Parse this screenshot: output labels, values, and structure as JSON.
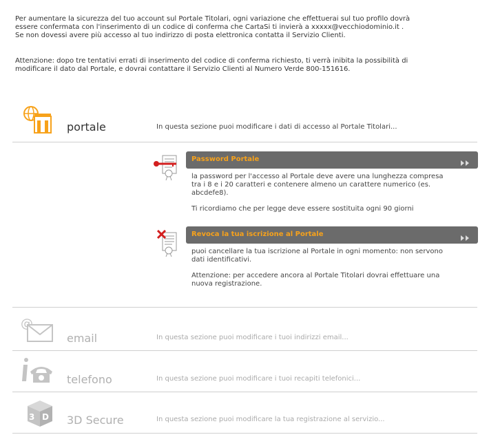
{
  "intro": {
    "line1": "Per aumentare la sicurezza del tuo account sul Portale Titolari, ogni variazione che effettuerai sul tuo profilo dovrà",
    "line2": "essere confermata con l'inserimento di un codice di conferma che CartaSi ti invierà a xxxxx@vecchiodominio.it .",
    "line3": "Se non dovessi avere più accesso al tuo indirizzo di posta elettronica contatta il Servizio Clienti.",
    "warn1": "Attenzione: dopo tre tentativi errati di inserimento del codice di conferma richiesto, ti verrà inibita la possibilità di",
    "warn2": "modificare il dato dal Portale, e dovrai contattare il Servizio Clienti al Numero Verde 800-151616."
  },
  "sections": {
    "portale": {
      "title": "portale",
      "desc": "In questa sezione puoi modificare i dati di accesso al Portale Titolari..."
    },
    "email": {
      "title": "email",
      "desc": "In questa sezione puoi modificare i tuoi indirizzi email..."
    },
    "telefono": {
      "title": "telefono",
      "desc": "In questa sezione puoi modificare i tuoi recapiti telefonici..."
    },
    "secure": {
      "title": "3D Secure",
      "desc": "In questa sezione puoi modificare la tua registrazione al servizio..."
    }
  },
  "password": {
    "label": "Password Portale",
    "text1": "la password per l'accesso al Portale deve avere una lunghezza compresa",
    "text2": "tra i 8 e i 20 caratteri e contenere almeno un carattere numerico (es.",
    "text3": "abcdefe8).",
    "text4": "Ti ricordiamo che per legge deve essere sostituita ogni 90 giorni"
  },
  "revoca": {
    "label": "Revoca la tua iscrizione al Portale",
    "text1": "puoi cancellare la tua iscrizione al Portale in ogni momento: non servono",
    "text2": "dati identificativi.",
    "text3": "Attenzione: per accedere ancora al Portale Titolari dovrai effettuare una",
    "text4": "nuova registrazione."
  },
  "colors": {
    "accent": "#f7a21b",
    "bar": "#6b6b6b",
    "inactive": "#b0b0b0",
    "active_title": "#333333"
  },
  "icons": {
    "portale": "building-globe-icon",
    "password": "key-document-icon",
    "revoca": "x-document-icon",
    "email": "email-envelope-icon",
    "telefono": "telephone-info-icon",
    "secure": "3d-cube-icon",
    "arrow": "double-arrow-icon"
  }
}
